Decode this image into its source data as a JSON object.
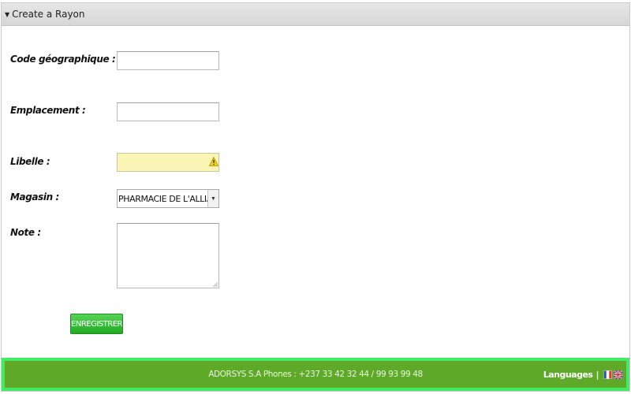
{
  "panel": {
    "title": "Create a Rayon"
  },
  "form": {
    "code_label": "Code géographique :",
    "code_value": "",
    "emplacement_label": "Emplacement :",
    "emplacement_value": "",
    "libelle_label": "Libelle :",
    "libelle_value": "",
    "magasin_label": "Magasin :",
    "magasin_selected": "PHARMACIE DE L'ALLIANCE",
    "note_label": "Note :",
    "note_value": "",
    "submit_label": "ENREGISTRER"
  },
  "footer": {
    "contact": "ADORSYS S.A Phones : +237 33 42 32 44 / 99 93 99 48",
    "languages_label": "Languages",
    "separator": "|",
    "flags": [
      "france-flag-icon",
      "uk-flag-icon"
    ]
  },
  "colors": {
    "header_bg": "#dddddd",
    "warning_field_bg": "#fbf5b6",
    "button_green": "#2fbb2f",
    "footer_outer": "#43ea63",
    "footer_inner": "#5fa928"
  },
  "icons": [
    "disclosure-triangle-icon",
    "warning-icon",
    "dropdown-arrow-icon",
    "resize-grip-icon"
  ]
}
